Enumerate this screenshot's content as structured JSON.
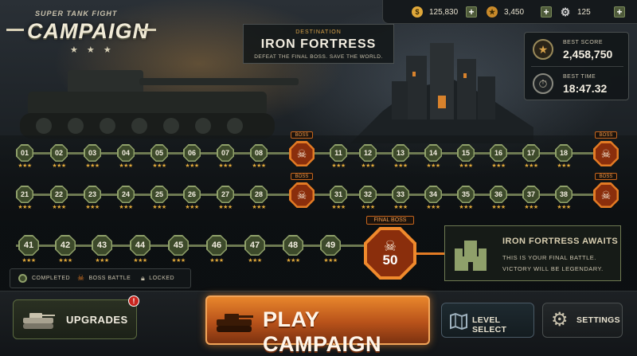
{
  "logo": {
    "subtitle": "SUPER TANK FIGHT",
    "title": "CAMPAIGN",
    "stars": "★ ★ ★"
  },
  "currencies": [
    {
      "icon": "coin-icon",
      "value": "125,830"
    },
    {
      "icon": "star-medal-icon",
      "value": "3,450"
    },
    {
      "icon": "gear-icon",
      "value": "125"
    }
  ],
  "destination": {
    "label": "DESTINATION",
    "title": "IRON FORTRESS",
    "description": "DEFEAT THE FINAL BOSS. SAVE THE WORLD."
  },
  "stats": {
    "best_score_label": "BEST SCORE",
    "best_score": "2,458,750",
    "best_time_label": "BEST TIME",
    "best_time": "18:47.32"
  },
  "boss_tag": "BOSS",
  "rows": [
    {
      "levels": [
        "01",
        "02",
        "03",
        "04",
        "05",
        "06",
        "07",
        "08"
      ],
      "levels_b": [
        "11",
        "12",
        "13",
        "14",
        "15",
        "16",
        "17",
        "18"
      ]
    },
    {
      "levels": [
        "21",
        "22",
        "23",
        "24",
        "25",
        "26",
        "27",
        "28"
      ],
      "levels_b": [
        "31",
        "32",
        "33",
        "34",
        "35",
        "36",
        "37",
        "38"
      ]
    }
  ],
  "row3": [
    "41",
    "42",
    "43",
    "44",
    "45",
    "46",
    "47",
    "48",
    "49"
  ],
  "stars": "★★★",
  "final_boss": {
    "tag": "FINAL BOSS",
    "number": "50"
  },
  "awaits": {
    "title": "IRON FORTRESS AWAITS",
    "line1": "THIS IS YOUR FINAL BATTLE.",
    "line2": "VICTORY WILL BE LEGENDARY."
  },
  "legend": {
    "completed": "COMPLETED",
    "boss": "BOSS BATTLE",
    "locked": "LOCKED"
  },
  "buttons": {
    "upgrades": "UPGRADES",
    "upgrades_badge": "!",
    "play": "PLAY CAMPAIGN",
    "level_select": "LEVEL SELECT",
    "settings": "SETTINGS"
  },
  "colors": {
    "accent": "#e37b24",
    "completed": "#8fa06a",
    "boss": "#8a2e0c"
  }
}
